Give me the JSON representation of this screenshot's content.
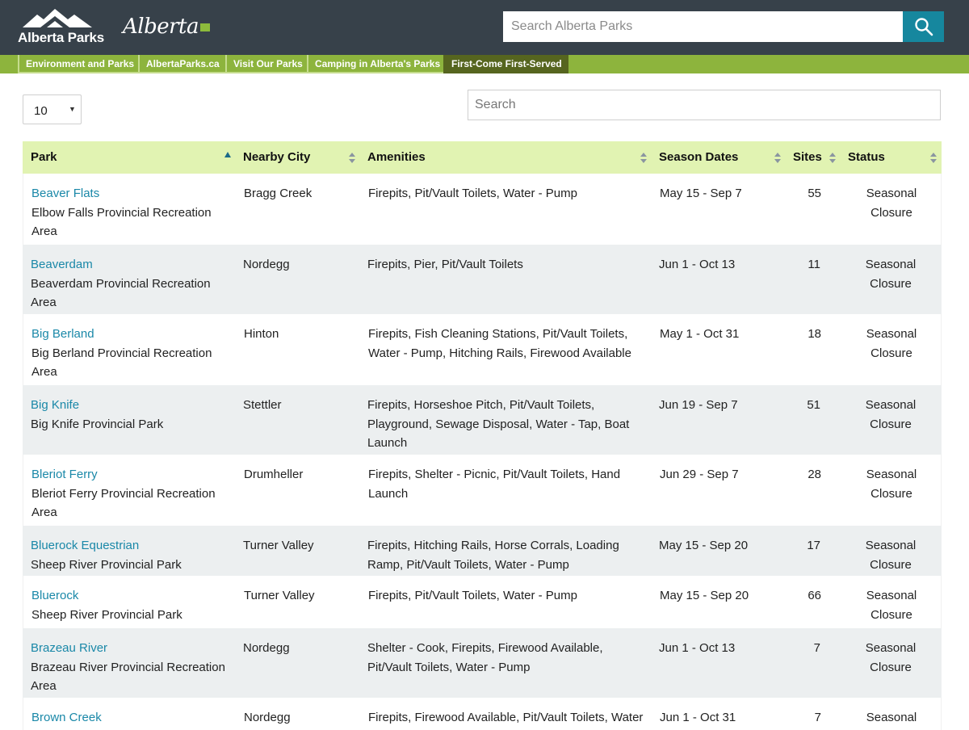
{
  "header": {
    "parks_logo_text": "Alberta Parks",
    "alberta_logo_text": "Alberta",
    "site_search_placeholder": "Search Alberta Parks"
  },
  "nav": [
    {
      "label": "Environment and Parks",
      "active": false
    },
    {
      "label": "AlbertaParks.ca",
      "active": false
    },
    {
      "label": "Visit Our Parks",
      "active": false
    },
    {
      "label": "Camping in Alberta's Parks",
      "active": false
    },
    {
      "label": "First-Come First-Served",
      "active": true
    }
  ],
  "controls": {
    "page_length": "10",
    "search_placeholder": "Search"
  },
  "table": {
    "columns": [
      {
        "label": "Park",
        "sort": "asc"
      },
      {
        "label": "Nearby City",
        "sort": "none"
      },
      {
        "label": "Amenities",
        "sort": "none"
      },
      {
        "label": "Season Dates",
        "sort": "none"
      },
      {
        "label": "Sites",
        "sort": "none"
      },
      {
        "label": "Status",
        "sort": "none"
      }
    ],
    "rows": [
      {
        "park": "Beaver Flats",
        "area": "Elbow Falls Provincial Recreation Area",
        "city": "Bragg Creek",
        "amenities": "Firepits, Pit/Vault Toilets, Water - Pump",
        "season": "May 15 - Sep 7",
        "sites": "55",
        "status": "Seasonal Closure"
      },
      {
        "park": "Beaverdam",
        "area": "Beaverdam Provincial Recreation Area",
        "city": "Nordegg",
        "amenities": "Firepits, Pier, Pit/Vault Toilets",
        "season": "Jun 1 - Oct 13",
        "sites": "11",
        "status": "Seasonal Closure"
      },
      {
        "park": "Big Berland",
        "area": "Big Berland Provincial Recreation Area",
        "city": "Hinton",
        "amenities": "Firepits, Fish Cleaning Stations, Pit/Vault Toilets, Water - Pump, Hitching Rails, Firewood Available",
        "season": "May 1 - Oct 31",
        "sites": "18",
        "status": "Seasonal Closure"
      },
      {
        "park": "Big Knife",
        "area": "Big Knife Provincial Park",
        "city": "Stettler",
        "amenities": "Firepits, Horseshoe Pitch, Pit/Vault Toilets, Playground, Sewage Disposal, Water - Tap, Boat Launch",
        "season": "Jun 19 - Sep 7",
        "sites": "51",
        "status": "Seasonal Closure"
      },
      {
        "park": "Bleriot Ferry",
        "area": "Bleriot Ferry Provincial Recreation Area",
        "city": "Drumheller",
        "amenities": "Firepits, Shelter - Picnic, Pit/Vault Toilets, Hand Launch",
        "season": "Jun 29 - Sep 7",
        "sites": "28",
        "status": "Seasonal Closure"
      },
      {
        "park": "Bluerock Equestrian",
        "area": "Sheep River Provincial Park",
        "city": "Turner Valley",
        "amenities": "Firepits, Hitching Rails, Horse Corrals, Loading Ramp, Pit/Vault Toilets, Water - Pump",
        "season": "May 15 - Sep 20",
        "sites": "17",
        "status": "Seasonal Closure"
      },
      {
        "park": "Bluerock",
        "area": "Sheep River Provincial Park",
        "city": "Turner Valley",
        "amenities": "Firepits, Pit/Vault Toilets, Water - Pump",
        "season": "May 15 - Sep 20",
        "sites": "66",
        "status": "Seasonal Closure"
      },
      {
        "park": "Brazeau River",
        "area": "Brazeau River Provincial Recreation Area",
        "city": "Nordegg",
        "amenities": "Shelter - Cook, Firepits, Firewood Available, Pit/Vault Toilets, Water - Pump",
        "season": "Jun 1 - Oct 13",
        "sites": "7",
        "status": "Seasonal Closure"
      },
      {
        "park": "Brown Creek",
        "area": "",
        "city": "Nordegg",
        "amenities": "Firepits, Firewood Available, Pit/Vault Toilets, Water",
        "season": "Jun 1 - Oct 31",
        "sites": "7",
        "status": "Seasonal"
      }
    ]
  }
}
